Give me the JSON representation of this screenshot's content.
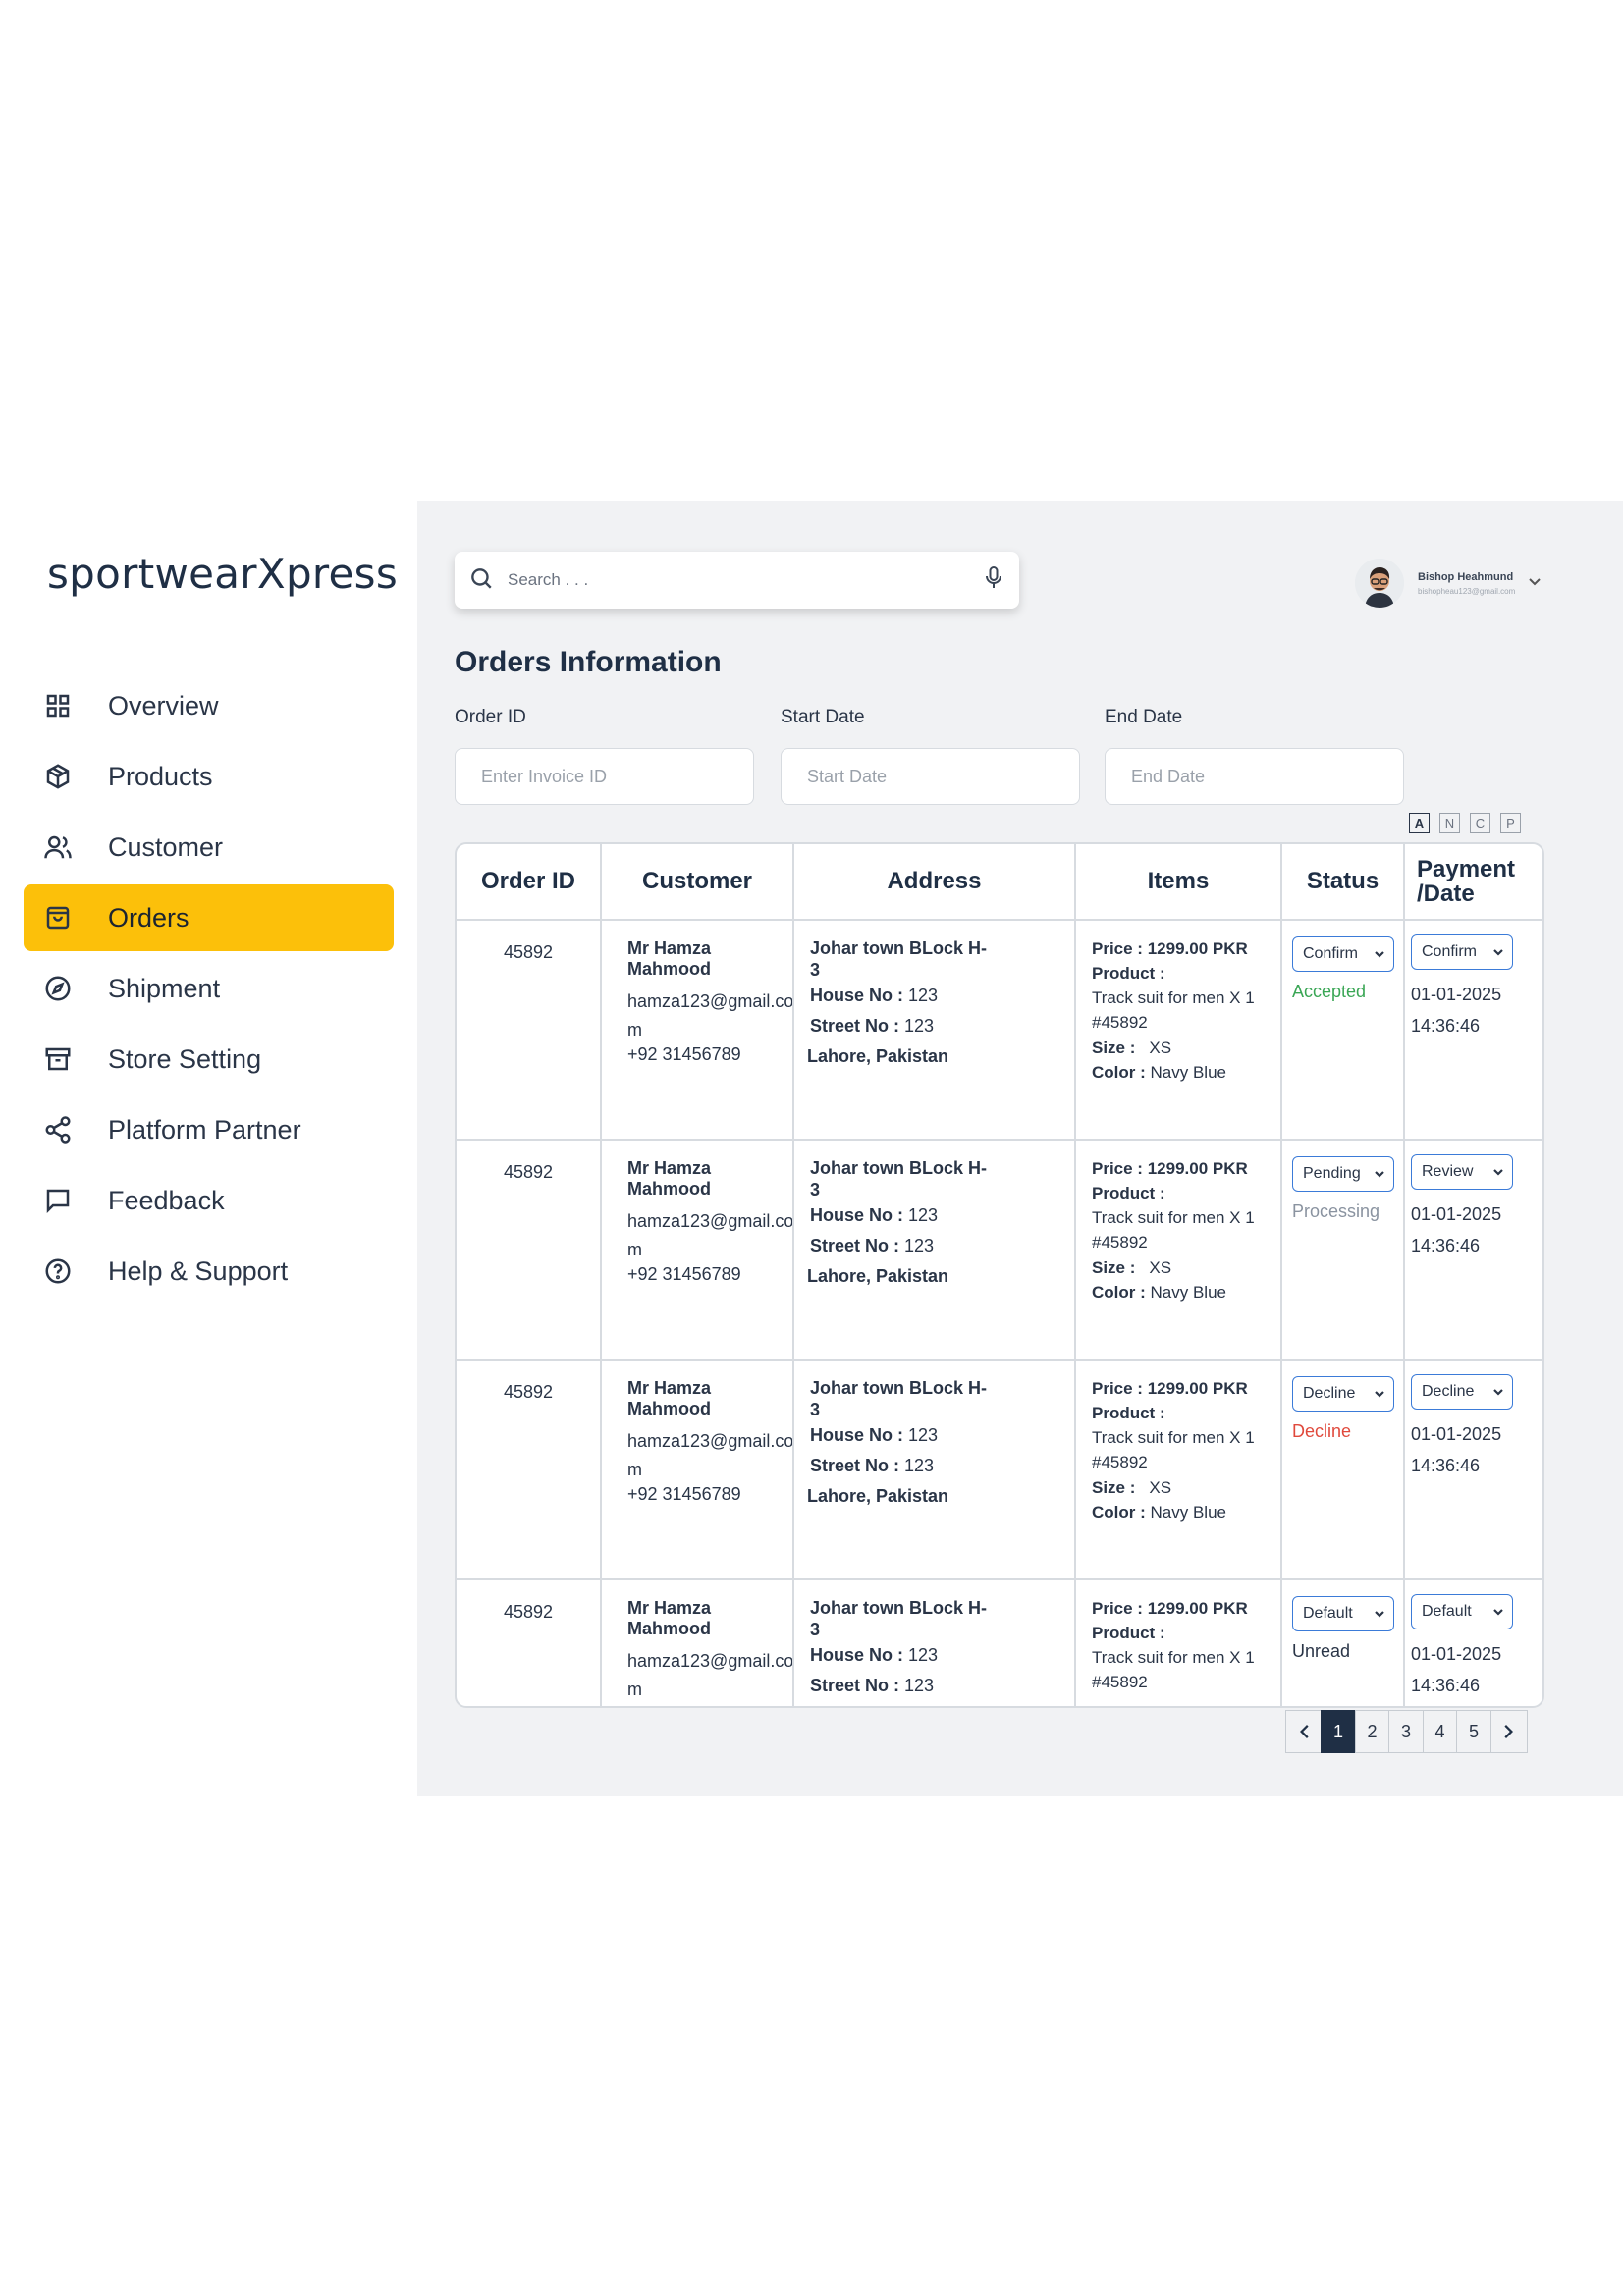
{
  "brand": {
    "logo": "sportwearXpress",
    "accent": "#fcc00a"
  },
  "sidebar": {
    "items": [
      {
        "label": "Overview",
        "icon": "grid-icon",
        "active": false
      },
      {
        "label": "Products",
        "icon": "box-icon",
        "active": false
      },
      {
        "label": "Customer",
        "icon": "users-icon",
        "active": false
      },
      {
        "label": "Orders",
        "icon": "shopping-bag-icon",
        "active": true
      },
      {
        "label": "Shipment",
        "icon": "compass-icon",
        "active": false
      },
      {
        "label": "Store Setting",
        "icon": "store-icon",
        "active": false
      },
      {
        "label": "Platform Partner",
        "icon": "share-icon",
        "active": false
      },
      {
        "label": "Feedback",
        "icon": "message-square-icon",
        "active": false
      },
      {
        "label": "Help & Support",
        "icon": "help-circle-icon",
        "active": false
      }
    ]
  },
  "header": {
    "search_placeholder": "Search . . .",
    "user": {
      "name": "Bishop Heahmund",
      "email": "bishopheau123@gmail.com"
    }
  },
  "page": {
    "title": "Orders Information",
    "filters": {
      "order_id": {
        "label": "Order ID",
        "placeholder": "Enter Invoice ID"
      },
      "start_date": {
        "label": "Start Date",
        "placeholder": "Start Date"
      },
      "end_date": {
        "label": "End Date",
        "placeholder": "End Date"
      }
    },
    "view_toggles": [
      "A",
      "N",
      "C",
      "P"
    ]
  },
  "table": {
    "headers": [
      "Order ID",
      "Customer",
      "Address",
      "Items",
      "Status",
      "Payment /Date"
    ],
    "rows": [
      {
        "order_id": "45892",
        "customer": {
          "name": "Mr Hamza Mahmood",
          "email": "hamza123@gmail.com",
          "phone": "+92 31456789"
        },
        "address": {
          "line1": "Johar town BLock H-3",
          "house_label": "House No :",
          "house": "123",
          "street_label": "Street No :",
          "street": "123",
          "city": "Lahore, Pakistan"
        },
        "items": {
          "price_label": "Price :",
          "price": "1299.00 PKR",
          "product_label": "Product :",
          "product": "Track suit for men X 1",
          "sku": "#45892",
          "size_label": "Size :",
          "size": "XS",
          "color_label": "Color :",
          "color": "Navy Blue"
        },
        "status": {
          "select": "Confirm",
          "text": "Accepted",
          "color": "#3aa655"
        },
        "payment": {
          "select": "Confirm",
          "date": "01-01-2025",
          "time": "14:36:46"
        }
      },
      {
        "order_id": "45892",
        "customer": {
          "name": "Mr Hamza Mahmood",
          "email": "hamza123@gmail.com",
          "phone": "+92 31456789"
        },
        "address": {
          "line1": "Johar town BLock H-3",
          "house_label": "House No :",
          "house": "123",
          "street_label": "Street No :",
          "street": "123",
          "city": "Lahore, Pakistan"
        },
        "items": {
          "price_label": "Price :",
          "price": "1299.00 PKR",
          "product_label": "Product :",
          "product": "Track suit for men X 1",
          "sku": "#45892",
          "size_label": "Size :",
          "size": "XS",
          "color_label": "Color :",
          "color": "Navy Blue"
        },
        "status": {
          "select": "Pending",
          "text": "Processing",
          "color": "#8a93a0"
        },
        "payment": {
          "select": "Review",
          "date": "01-01-2025",
          "time": "14:36:46"
        }
      },
      {
        "order_id": "45892",
        "customer": {
          "name": "Mr Hamza Mahmood",
          "email": "hamza123@gmail.com",
          "phone": "+92 31456789"
        },
        "address": {
          "line1": "Johar town BLock H-3",
          "house_label": "House No :",
          "house": "123",
          "street_label": "Street No :",
          "street": "123",
          "city": "Lahore, Pakistan"
        },
        "items": {
          "price_label": "Price :",
          "price": "1299.00 PKR",
          "product_label": "Product :",
          "product": "Track suit for men X 1",
          "sku": "#45892",
          "size_label": "Size :",
          "size": "XS",
          "color_label": "Color :",
          "color": "Navy Blue"
        },
        "status": {
          "select": "Decline",
          "text": "Decline",
          "color": "#e0493c"
        },
        "payment": {
          "select": "Decline",
          "date": "01-01-2025",
          "time": "14:36:46"
        }
      },
      {
        "order_id": "45892",
        "customer": {
          "name": "Mr Hamza Mahmood",
          "email": "hamza123@gmail.com",
          "phone": ""
        },
        "address": {
          "line1": "Johar town BLock H-3",
          "house_label": "House No :",
          "house": "123",
          "street_label": "Street No :",
          "street": "123",
          "city": ""
        },
        "items": {
          "price_label": "Price :",
          "price": "1299.00 PKR",
          "product_label": "Product :",
          "product": "Track suit for men X 1",
          "sku": "#45892",
          "size_label": "",
          "size": "",
          "color_label": "",
          "color": ""
        },
        "status": {
          "select": "Default",
          "text": "Unread",
          "color": "#2a3547"
        },
        "payment": {
          "select": "Default",
          "date": "01-01-2025",
          "time": "14:36:46"
        }
      }
    ]
  },
  "pagination": {
    "pages": [
      "1",
      "2",
      "3",
      "4",
      "5"
    ],
    "current": "1"
  }
}
